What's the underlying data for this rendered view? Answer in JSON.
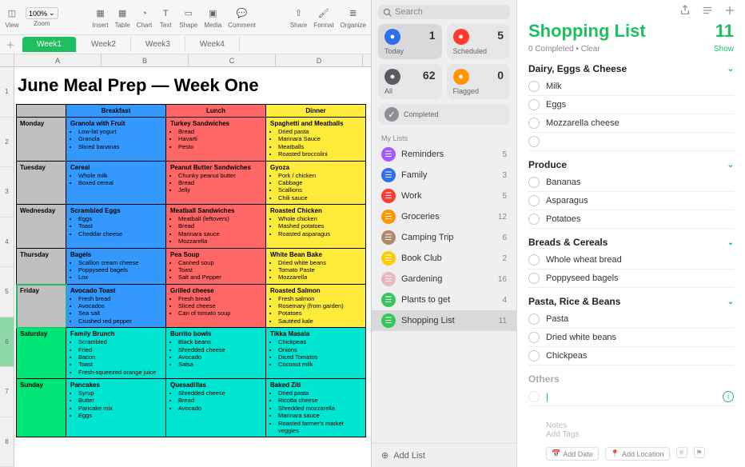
{
  "numbers": {
    "zoom": "100%",
    "toolbar": [
      "View",
      "Zoom",
      "Insert",
      "Table",
      "Chart",
      "Text",
      "Shape",
      "Media",
      "Comment",
      "Share",
      "Format",
      "Organize"
    ],
    "tabs": [
      "Week1",
      "Week2",
      "Week3",
      "Week4"
    ],
    "active_tab": 0,
    "columns": [
      "A",
      "B",
      "C",
      "D"
    ],
    "title": "June Meal Prep — Week One",
    "headers": [
      "Breakfast",
      "Lunch",
      "Dinner"
    ],
    "rows": [
      {
        "day": "Monday",
        "dc": "c-grey",
        "meals": [
          {
            "c": "c-blue",
            "h": "Granola with Fruit",
            "items": [
              "Low-fat yogurt",
              "Granola",
              "Sliced bananas"
            ]
          },
          {
            "c": "c-red",
            "h": "Turkey Sandwiches",
            "items": [
              "Bread",
              "Havarti",
              "Pesto"
            ]
          },
          {
            "c": "c-yellow",
            "h": "Spaghetti and Meatballs",
            "items": [
              "Dried pasta",
              "Marinara Sauce",
              "Meatballs",
              "Roasted broccolini"
            ]
          }
        ]
      },
      {
        "day": "Tuesday",
        "dc": "c-grey",
        "meals": [
          {
            "c": "c-blue",
            "h": "Cereal",
            "items": [
              "Whole milk",
              "Boxed cereal"
            ]
          },
          {
            "c": "c-red",
            "h": "Peanut Butter Sandwiches",
            "items": [
              "Chunky peanut butter",
              "Bread",
              "Jelly"
            ]
          },
          {
            "c": "c-yellow",
            "h": "Gyoza",
            "items": [
              "Pork / chicken",
              "Cabbage",
              "Scallions",
              "Chili sauce"
            ]
          }
        ]
      },
      {
        "day": "Wednesday",
        "dc": "c-grey",
        "meals": [
          {
            "c": "c-blue",
            "h": "Scrambled Eggs",
            "items": [
              "Eggs",
              "Toast",
              "Cheddar cheese"
            ]
          },
          {
            "c": "c-red",
            "h": "Meatball Sandwiches",
            "items": [
              "Meatball (leftovers)",
              "Bread",
              "Marinara sauce",
              "Mozzarella"
            ]
          },
          {
            "c": "c-yellow",
            "h": "Roasted Chicken",
            "items": [
              "Whole chicken",
              "Mashed potatoes",
              "Roasted asparagus"
            ]
          }
        ]
      },
      {
        "day": "Thursday",
        "dc": "c-grey",
        "meals": [
          {
            "c": "c-blue",
            "h": "Bagels",
            "items": [
              "Scallion cream cheese",
              "Poppyseed bagels",
              "Lox"
            ]
          },
          {
            "c": "c-red",
            "h": "Pea Soup",
            "items": [
              "Canned soup",
              "Toast",
              "Salt and Pepper"
            ]
          },
          {
            "c": "c-yellow",
            "h": "White Bean Bake",
            "items": [
              "Dried white beans",
              "Tomato Paste",
              "Mozzarella"
            ]
          }
        ]
      },
      {
        "day": "Friday",
        "sel": true,
        "dc": "c-grey",
        "meals": [
          {
            "c": "c-blue",
            "h": "Avocado Toast",
            "items": [
              "Fresh bread",
              "Avocados",
              "Sea salt",
              "Crushed red pepper"
            ]
          },
          {
            "c": "c-red",
            "h": "Grilled cheese",
            "items": [
              "Fresh bread",
              "Sliced cheese",
              "Can of tomato soup"
            ]
          },
          {
            "c": "c-yellow",
            "h": "Roasted Salmon",
            "items": [
              "Fresh salmon",
              "Rosemary (from garden)",
              "Potatoes",
              "Sautéed kale"
            ]
          }
        ]
      },
      {
        "day": "Saturday",
        "dc": "c-green",
        "meals": [
          {
            "c": "c-cyan",
            "h": "Family Brunch",
            "items": [
              "Scrambled",
              "Fried",
              "Bacon",
              "Toast",
              "Fresh-squeezed orange juice"
            ]
          },
          {
            "c": "c-cyan",
            "h": "Burrito bowls",
            "items": [
              "Black beans",
              "Shredded cheese",
              "Avocado",
              "Salsa"
            ]
          },
          {
            "c": "c-cyan",
            "h": "Tikka Masala",
            "items": [
              "Chickpeas",
              "Onions",
              "Diced Tomatos",
              "Coconut milk"
            ]
          }
        ]
      },
      {
        "day": "Sunday",
        "dc": "c-green",
        "meals": [
          {
            "c": "c-cyan",
            "h": "Pancakes",
            "items": [
              "Syrup",
              "Butter",
              "Pancake mix",
              "Eggs"
            ]
          },
          {
            "c": "c-cyan",
            "h": "Quesadillas",
            "items": [
              "Shredded cheese",
              "Bread",
              "Avocado"
            ]
          },
          {
            "c": "c-cyan",
            "h": "Baked Ziti",
            "items": [
              "Dried pasta",
              "Ricotta cheese",
              "Shredded mozzarella",
              "Marinara sauce",
              "Roasted farmer's market veggies"
            ]
          }
        ]
      }
    ]
  },
  "reminders": {
    "search_ph": "Search",
    "smart": [
      {
        "label": "Today",
        "count": 1,
        "color": "#2f6fed"
      },
      {
        "label": "Scheduled",
        "count": 5,
        "color": "#ff3b30"
      },
      {
        "label": "All",
        "count": 62,
        "color": "#5b5b5f"
      },
      {
        "label": "Flagged",
        "count": 0,
        "color": "#ff9500"
      }
    ],
    "completed_label": "Completed",
    "mylists_label": "My Lists",
    "lists": [
      {
        "name": "Reminders",
        "count": 5,
        "color": "#a259ff"
      },
      {
        "name": "Family",
        "count": 3,
        "color": "#2f6fed"
      },
      {
        "name": "Work",
        "count": 5,
        "color": "#ff3b30"
      },
      {
        "name": "Groceries",
        "count": 12,
        "color": "#ff9500"
      },
      {
        "name": "Camping Trip",
        "count": 6,
        "color": "#b08968"
      },
      {
        "name": "Book Club",
        "count": 2,
        "color": "#ffcc00"
      },
      {
        "name": "Gardening",
        "count": 16,
        "color": "#e7b8c0"
      },
      {
        "name": "Plants to get",
        "count": 4,
        "color": "#34c759"
      },
      {
        "name": "Shopping List",
        "count": 11,
        "color": "#34c759",
        "selected": true
      }
    ],
    "add_list": "Add List"
  },
  "detail": {
    "title": "Shopping List",
    "count": "11",
    "completed": "0 Completed",
    "clear": "Clear",
    "show": "Show",
    "sections": [
      {
        "name": "Dairy, Eggs & Cheese",
        "items": [
          "Milk",
          "Eggs",
          "Mozzarella cheese"
        ],
        "extra_blank": true
      },
      {
        "name": "Produce",
        "items": [
          "Bananas",
          "Asparagus",
          "Potatoes"
        ]
      },
      {
        "name": "Breads & Cereals",
        "items": [
          "Whole wheat bread",
          "Poppyseed bagels"
        ]
      },
      {
        "name": "Pasta, Rice & Beans",
        "items": [
          "Pasta",
          "Dried white beans",
          "Chickpeas"
        ]
      },
      {
        "name": "Others",
        "muted": true,
        "items": []
      }
    ],
    "notes": "Notes",
    "tags": "Add Tags",
    "add_date": "Add Date",
    "add_location": "Add Location"
  }
}
